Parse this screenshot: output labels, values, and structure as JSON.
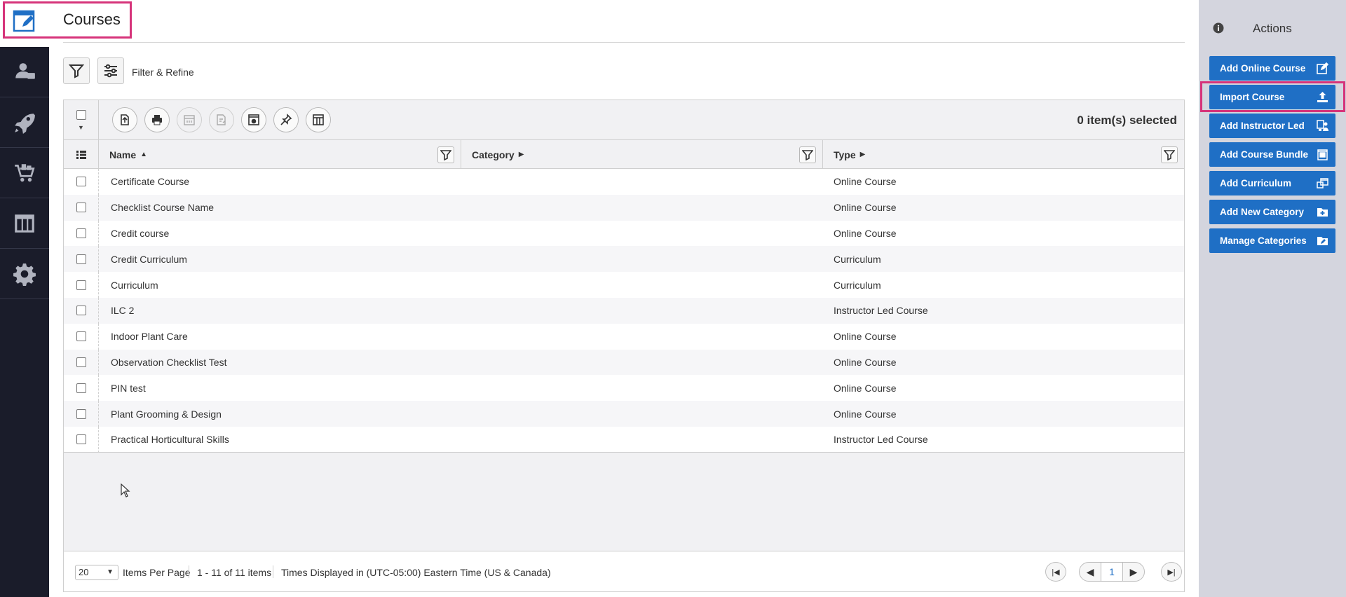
{
  "header": {
    "title": "Courses"
  },
  "filter_bar": {
    "label": "Filter & Refine"
  },
  "nav": {
    "items": [
      {
        "icon": "users-icon"
      },
      {
        "icon": "rocket-icon"
      },
      {
        "icon": "cart-icon"
      },
      {
        "icon": "columns-icon"
      },
      {
        "icon": "gear-icon"
      }
    ]
  },
  "toolbar": {
    "selected_count": "0 item(s) selected",
    "buttons": [
      {
        "icon": "export-icon"
      },
      {
        "icon": "print-icon"
      },
      {
        "icon": "calendar-icon"
      },
      {
        "icon": "list-edit-icon"
      },
      {
        "icon": "browser-settings-icon"
      },
      {
        "icon": "pin-icon"
      },
      {
        "icon": "table-columns-icon"
      }
    ]
  },
  "columns": {
    "name": "Name",
    "category": "Category",
    "type": "Type"
  },
  "rows": [
    {
      "name": "Certificate Course",
      "category": "",
      "type": "Online Course"
    },
    {
      "name": "Checklist Course Name",
      "category": "",
      "type": "Online Course"
    },
    {
      "name": "Credit course",
      "category": "",
      "type": "Online Course"
    },
    {
      "name": "Credit Curriculum",
      "category": "",
      "type": "Curriculum"
    },
    {
      "name": "Curriculum",
      "category": "",
      "type": "Curriculum"
    },
    {
      "name": "ILC 2",
      "category": "",
      "type": "Instructor Led Course"
    },
    {
      "name": "Indoor Plant Care",
      "category": "",
      "type": "Online Course"
    },
    {
      "name": "Observation Checklist Test",
      "category": "",
      "type": "Online Course"
    },
    {
      "name": "PIN test",
      "category": "",
      "type": "Online Course"
    },
    {
      "name": "Plant Grooming & Design",
      "category": "",
      "type": "Online Course"
    },
    {
      "name": "Practical Horticultural Skills",
      "category": "",
      "type": "Instructor Led Course"
    }
  ],
  "pager": {
    "page_size": "20",
    "items_per_page_label": "Items Per Page",
    "range": "1 - 11 of 11 items",
    "timezone": "Times Displayed in (UTC-05:00) Eastern Time (US & Canada)",
    "current_page": "1"
  },
  "actions": {
    "title": "Actions",
    "buttons": [
      {
        "label": "Add Online Course",
        "icon": "edit-box-icon"
      },
      {
        "label": "Import Course",
        "icon": "upload-icon"
      },
      {
        "label": "Add Instructor Led",
        "icon": "instructor-icon"
      },
      {
        "label": "Add Course Bundle",
        "icon": "bundle-icon"
      },
      {
        "label": "Add Curriculum",
        "icon": "curriculum-icon"
      },
      {
        "label": "Add New Category",
        "icon": "folder-plus-icon"
      },
      {
        "label": "Manage Categories",
        "icon": "folder-edit-icon"
      }
    ]
  },
  "colors": {
    "nav_bg": "#1a1c2a",
    "accent_blue": "#1f6fc5",
    "highlight_pink": "#d6337a",
    "panel_bg": "#d4d5de"
  }
}
